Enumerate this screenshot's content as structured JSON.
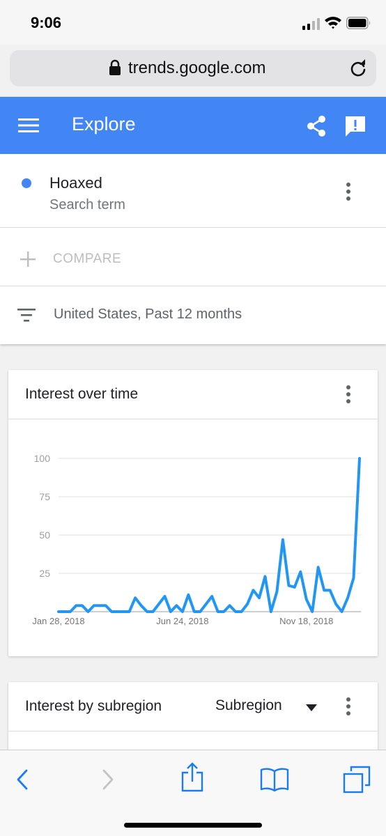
{
  "status": {
    "time": "9:06"
  },
  "browser": {
    "url": "trends.google.com"
  },
  "appbar": {
    "title": "Explore"
  },
  "search": {
    "term": "Hoaxed",
    "term_sublabel": "Search term",
    "term_color": "#4285f4",
    "compare_label": "COMPARE",
    "filter_text": "United States, Past 12 months"
  },
  "cards": {
    "interest_over_time": {
      "title": "Interest over time"
    },
    "interest_by_subregion": {
      "title": "Interest by subregion",
      "select_value": "Subregion"
    }
  },
  "chart_data": {
    "type": "line",
    "title": "Interest over time",
    "x_tick_labels": [
      "Jan 28, 2018",
      "Jun 24, 2018",
      "Nov 18, 2018"
    ],
    "x_tick_indices": [
      0,
      21,
      42
    ],
    "y_ticks": [
      100,
      75,
      50,
      25
    ],
    "ylim": [
      0,
      100
    ],
    "grid": true,
    "line_color": "#2196f3",
    "series": [
      {
        "values": [
          0,
          0,
          0,
          4,
          4,
          0,
          4,
          4,
          4,
          0,
          0,
          0,
          0,
          9,
          4,
          0,
          0,
          5,
          10,
          0,
          4,
          0,
          11,
          0,
          0,
          5,
          10,
          0,
          0,
          4,
          0,
          0,
          5,
          14,
          9,
          23,
          0,
          13,
          47,
          17,
          16,
          26,
          8,
          0,
          29,
          14,
          14,
          5,
          0,
          9,
          22,
          100
        ]
      }
    ]
  }
}
